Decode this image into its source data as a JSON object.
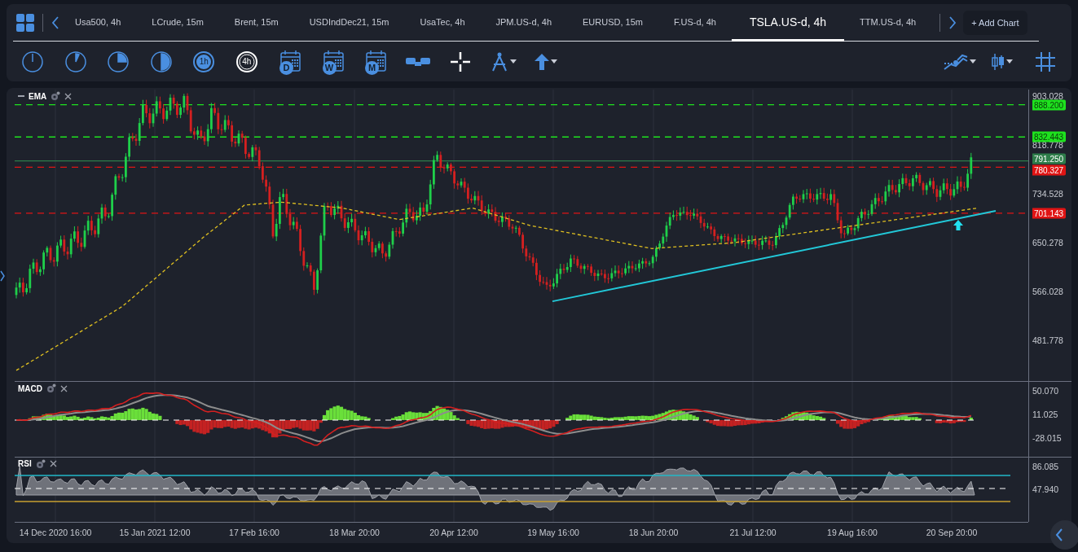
{
  "header": {
    "tabs": [
      {
        "label": "Usa500, 4h",
        "selected": false
      },
      {
        "label": "LCrude, 15m",
        "selected": false
      },
      {
        "label": "Brent, 15m",
        "selected": false
      },
      {
        "label": "USDIndDec21, 15m",
        "selected": false
      },
      {
        "label": "UsaTec, 4h",
        "selected": false
      },
      {
        "label": "JPM.US-d, 4h",
        "selected": false
      },
      {
        "label": "EURUSD, 15m",
        "selected": false
      },
      {
        "label": "F.US-d, 4h",
        "selected": false
      },
      {
        "label": "TSLA.US-d, 4h",
        "selected": true
      },
      {
        "label": "TTM.US-d, 4h",
        "selected": false
      }
    ],
    "add_chart": "+ Add Chart"
  },
  "toolbar": {
    "timeframes": [
      {
        "kind": "tick",
        "selected": false
      },
      {
        "kind": "eighth",
        "selected": false
      },
      {
        "kind": "quarter",
        "selected": false
      },
      {
        "kind": "half",
        "selected": false
      },
      {
        "kind": "ring",
        "label": "1h",
        "selected": false
      },
      {
        "kind": "ring",
        "label": "4h",
        "selected": true
      },
      {
        "kind": "calendar",
        "label": "D",
        "selected": false
      },
      {
        "kind": "calendar",
        "label": "W",
        "selected": false
      },
      {
        "kind": "calendar",
        "label": "M",
        "selected": false
      }
    ]
  },
  "main_pane": {
    "title": "EMA",
    "yticks": [
      "903.028",
      "818.778",
      "734.528",
      "650.278",
      "566.028",
      "481.778"
    ],
    "levels": [
      {
        "label": "888.200",
        "color": "#1ee21e",
        "kind": "dashed"
      },
      {
        "label": "832.443",
        "color": "#1ee21e",
        "kind": "dashed"
      },
      {
        "label": "791.250",
        "color": "#2e7d4a",
        "kind": "solid"
      },
      {
        "label": "780.327",
        "color": "#e01414",
        "kind": "dashed"
      },
      {
        "label": "701.143",
        "color": "#e01414",
        "kind": "dashed"
      }
    ]
  },
  "macd_pane": {
    "title": "MACD",
    "yticks": [
      "50.070",
      "11.025",
      "-28.015"
    ]
  },
  "rsi_pane": {
    "title": "RSI",
    "yticks": [
      "86.085",
      "47.940"
    ]
  },
  "x_axis": [
    "14 Dec 2020 16:00",
    "15 Jan 2021 12:00",
    "17 Feb 16:00",
    "18 Mar 20:00",
    "20 Apr 12:00",
    "19 May 16:00",
    "18 Jun 20:00",
    "21 Jul 12:00",
    "19 Aug 16:00",
    "20 Sep 20:00"
  ]
}
